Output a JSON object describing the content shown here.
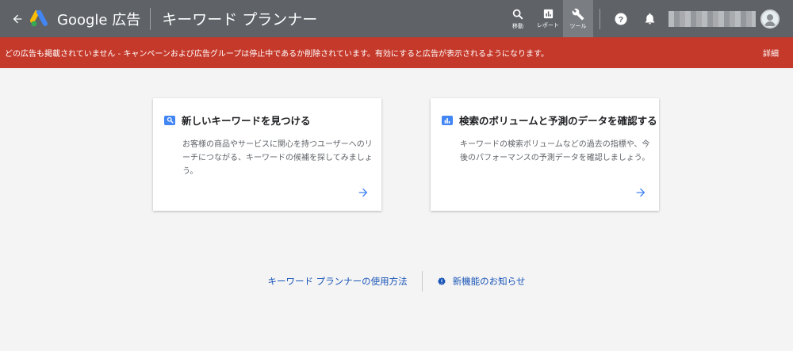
{
  "header": {
    "brand": "Google 広告",
    "page_title": "キーワード プランナー",
    "nav": [
      {
        "label": "移動",
        "icon": "search-icon"
      },
      {
        "label": "レポート",
        "icon": "report-icon"
      },
      {
        "label": "ツール",
        "icon": "wrench-icon"
      }
    ]
  },
  "alert": {
    "message": "どの広告も掲載されていません - キャンペーンおよび広告グループは停止中であるか削除されています。有効にすると広告が表示されるようになります。",
    "link": "詳細"
  },
  "cards": [
    {
      "title": "新しいキーワードを見つける",
      "description": "お客様の商品やサービスに関心を持つユーザーへのリーチにつながる、キーワードの候補を探してみましょう。",
      "icon": "search-icon",
      "accent": "#4285f4"
    },
    {
      "title": "検索のボリュームと予測のデータを確認する",
      "description": "キーワードの検索ボリュームなどの過去の指標や、今後のパフォーマンスの予測データを確認しましょう。",
      "icon": "bar-chart-icon",
      "accent": "#4285f4"
    }
  ],
  "footer": {
    "how_to": "キーワード プランナーの使用方法",
    "news": "新機能のお知らせ"
  },
  "colors": {
    "header_bg": "#5f6368",
    "alert_bg": "#c5392b",
    "link": "#1a55b8",
    "accent": "#4285f4"
  }
}
